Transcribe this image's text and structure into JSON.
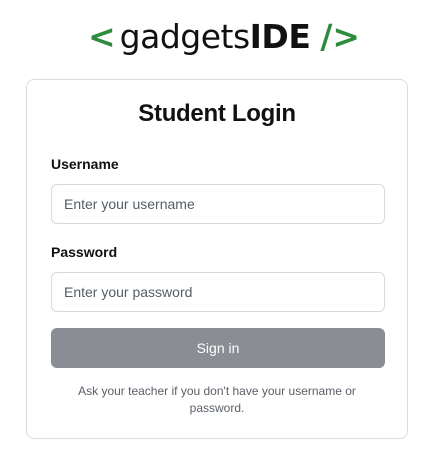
{
  "logo": {
    "open_bracket": "<",
    "name": "gadgets",
    "name_bold": "IDE",
    "close_bracket": "/>",
    "accent_color": "#2e8b3e"
  },
  "login": {
    "title": "Student Login",
    "username_label": "Username",
    "username_placeholder": "Enter your username",
    "username_value": "",
    "password_label": "Password",
    "password_placeholder": "Enter your password",
    "password_value": "",
    "signin_label": "Sign in",
    "signin_color": "#8a8d93",
    "help_text": "Ask your teacher if you don't have your username or password."
  }
}
